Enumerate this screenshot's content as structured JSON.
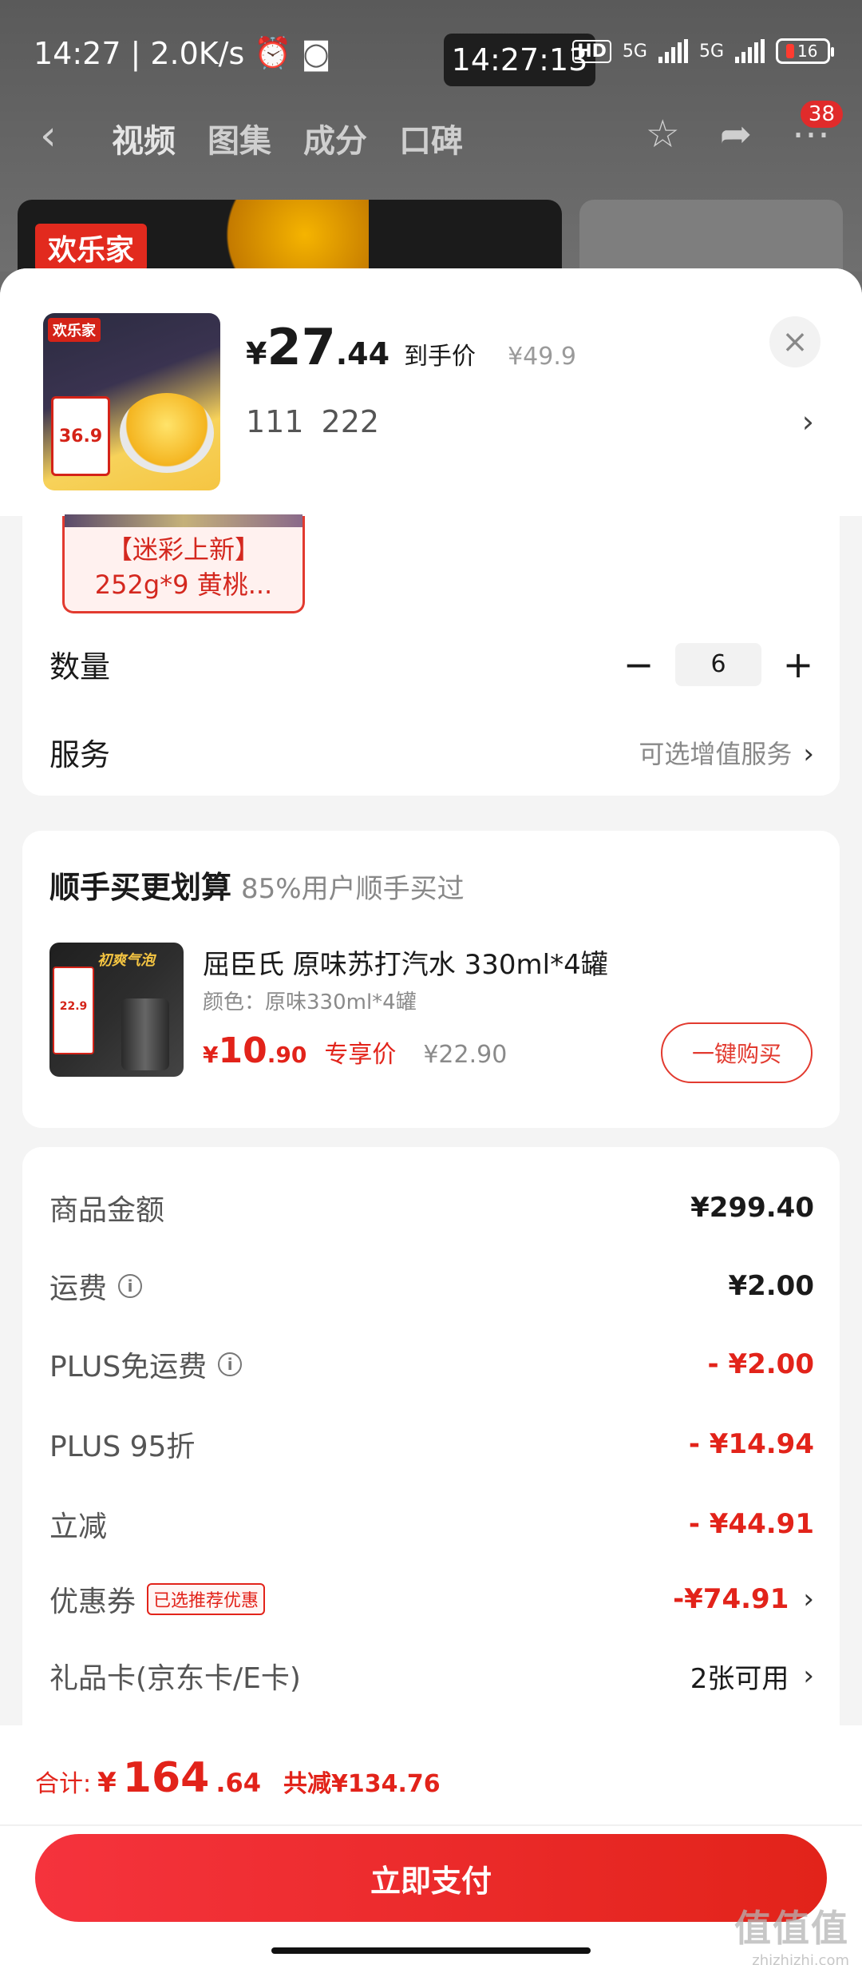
{
  "statusbar": {
    "time": "14:27",
    "speed": "2.0K/s",
    "clock_pill": "14:27:13",
    "hd": "HD",
    "net1": "5G",
    "net2": "5G",
    "battery": "16"
  },
  "navbar": {
    "tabs": [
      "视频",
      "图集",
      "成分",
      "口碑"
    ],
    "badge": "38"
  },
  "background": {
    "logo": "欢乐家"
  },
  "product": {
    "thumb_logo": "欢乐家",
    "thumb_price": "36.9",
    "price_currency": "¥",
    "price_int": "27",
    "price_dec": ".44",
    "price_tag": "到手价",
    "original_price": "¥49.9",
    "spec_1": "111",
    "spec_2": "222"
  },
  "variant": {
    "line1": "【迷彩上新】",
    "line2": "252g*9 黄桃..."
  },
  "quantity": {
    "label": "数量",
    "value": "6"
  },
  "service": {
    "label": "服务",
    "hint": "可选增值服务"
  },
  "addon": {
    "title": "顺手买更划算",
    "subtitle": "85%用户顺手买过",
    "thumb_text": "初爽气泡",
    "thumb_price": "22.9",
    "name": "屈臣氏 原味苏打汽水 330ml*4罐",
    "color": "颜色：原味330ml*4罐",
    "price_currency": "¥",
    "price_int": "10",
    "price_dec": ".90",
    "price_tag": "专享价",
    "original_price": "¥22.90",
    "buy_label": "一键购买"
  },
  "fees": [
    {
      "label": "商品金额",
      "value": "¥299.40"
    },
    {
      "label": "运费",
      "value": "¥2.00"
    },
    {
      "label": "PLUS免运费",
      "value": "- ¥2.00"
    },
    {
      "label": "PLUS 95折",
      "value": "- ¥14.94"
    },
    {
      "label": "立减",
      "value": "- ¥44.91"
    },
    {
      "label": "优惠券",
      "tag": "已选推荐优惠",
      "value": "-¥74.91"
    },
    {
      "label": "礼品卡(京东卡/E卡)",
      "value": "2张可用"
    }
  ],
  "footer": {
    "total_label": "合计:",
    "total_currency": "¥",
    "total_int": "164",
    "total_dec": ".64",
    "discount": "共减¥134.76",
    "pay_label": "立即支付"
  },
  "watermark": {
    "line1": "值值值",
    "line2": "zhizhizhi.com"
  },
  "colors": {
    "accent_red": "#e2231a",
    "sheet_bg": "#f4f4f4"
  }
}
